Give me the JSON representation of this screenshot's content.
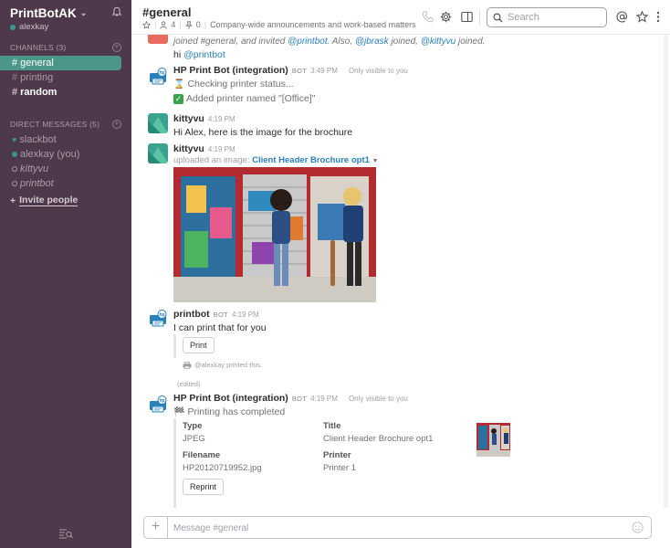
{
  "sidebar": {
    "team_name": "PrintBotAK",
    "user_name": "alexkay",
    "channels_label": "CHANNELS",
    "channels_count": "(3)",
    "channels": [
      {
        "name": "general"
      },
      {
        "name": "printing"
      },
      {
        "name": "random"
      }
    ],
    "dm_label": "DIRECT MESSAGES",
    "dm_count": "(5)",
    "dms": [
      {
        "name": "slackbot"
      },
      {
        "name": "alexkay (you)"
      },
      {
        "name": "kittyvu"
      },
      {
        "name": "printbot"
      }
    ],
    "invite_label": "Invite people",
    "accent": "#4c9689",
    "bg": "#4d394b"
  },
  "header": {
    "channel": "#general",
    "members": "4",
    "pins": "0",
    "topic": "Company-wide announcements and work-based matters",
    "search_placeholder": "Search"
  },
  "messages": {
    "join_text": "joined #general, and invited",
    "join_mention1": "@printbot",
    "join_also": ". Also,",
    "join_mention2": "@jbrask",
    "join_joined": "joined,",
    "join_mention3": "@kittyvu",
    "join_joined2": "joined.",
    "hi_prefix": "hi",
    "hi_mention": "@printbot",
    "m1": {
      "name": "HP Print Bot (integration)",
      "tag": "BOT",
      "time": "3:49 PM",
      "visibility": "Only visible to you",
      "line1": "Checking printer status...",
      "line2": "Added printer named \"[Office]\""
    },
    "m2": {
      "name": "kittyvu",
      "time": "4:19 PM",
      "text": "Hi Alex, here is the image for the brochure"
    },
    "m3": {
      "name": "kittyvu",
      "time": "4:19 PM",
      "uploaded": "uploaded an image:",
      "file": "Client Header Brochure opt1"
    },
    "m4": {
      "name": "printbot",
      "tag": "BOT",
      "time": "4:19 PM",
      "text": "I can print that for you",
      "button": "Print",
      "printed_note": "@alexkay printed this.",
      "edited": "(edited)"
    },
    "m5": {
      "name": "HP Print Bot (integration)",
      "tag": "BOT",
      "time": "4:19 PM",
      "visibility": "Only visible to you",
      "text": "Printing has completed",
      "type_label": "Type",
      "type_value": "JPEG",
      "title_label": "Title",
      "title_value": "Client Header Brochure opt1",
      "filename_label": "Filename",
      "filename_value": "HP20120719952.jpg",
      "printer_label": "Printer",
      "printer_value": "Printer 1",
      "button": "Reprint"
    }
  },
  "composer": {
    "placeholder": "Message #general"
  }
}
